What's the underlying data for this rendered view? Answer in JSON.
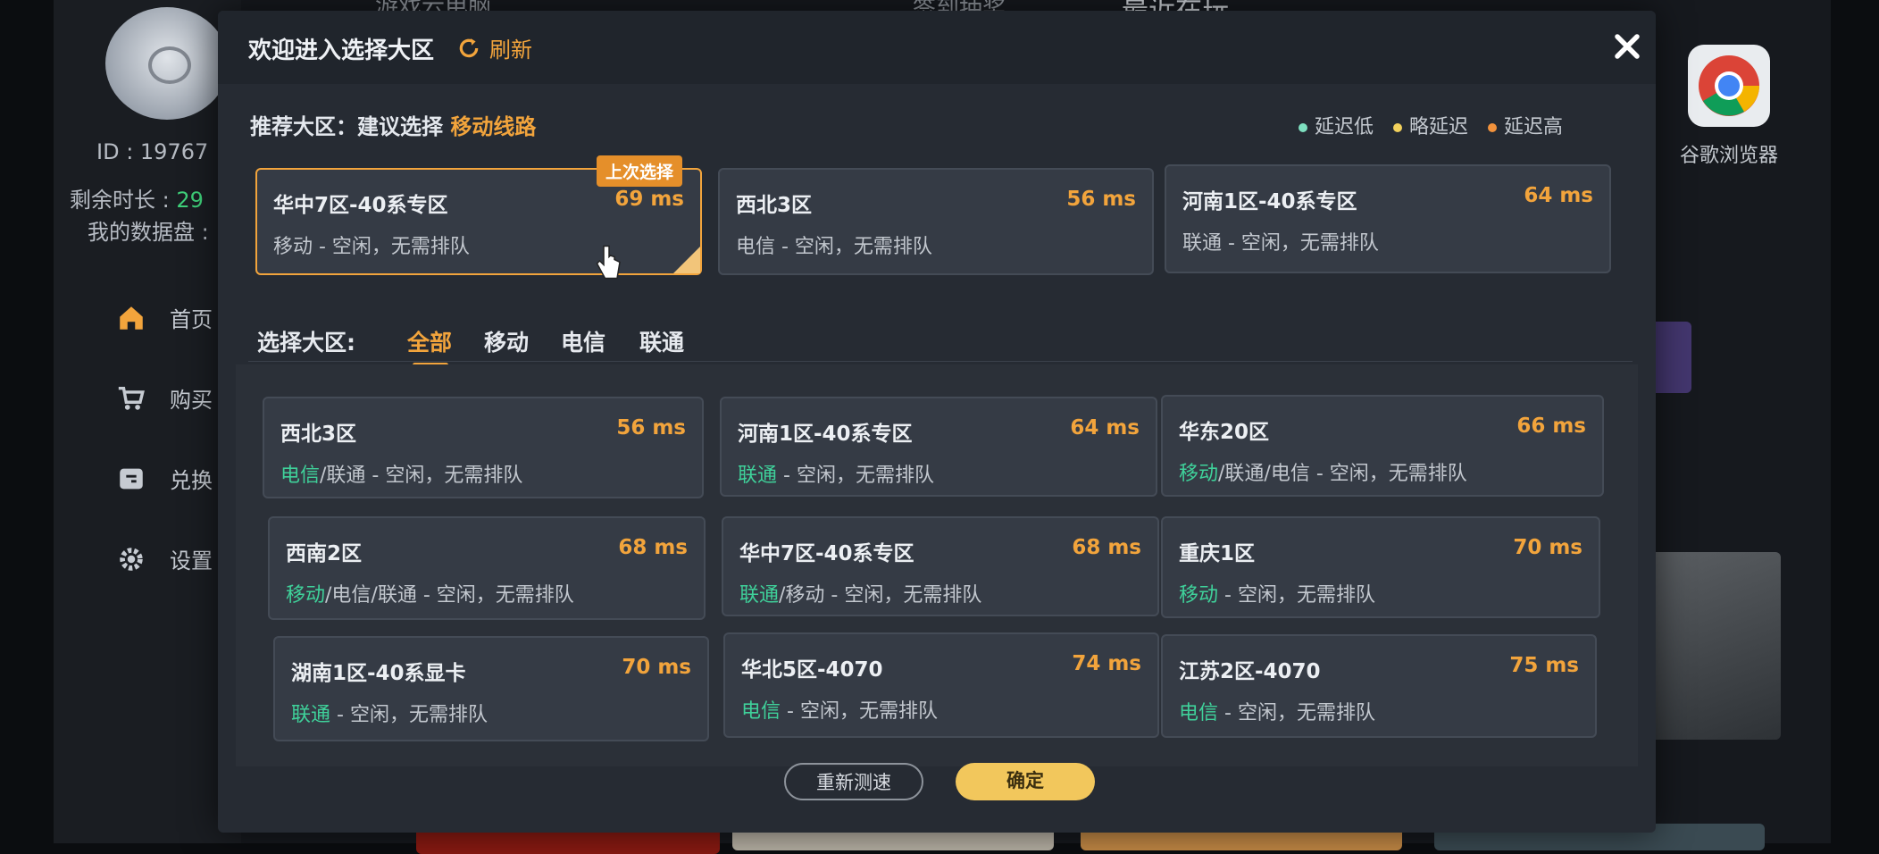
{
  "background_app": {
    "top_left_text": "游戏云电脑",
    "top_mid_text": "签到抽奖",
    "top_right_text": "最近在玩",
    "user_id": "ID : 19767",
    "remaining_time_label": "剩余时长 : ",
    "remaining_time_value": "29",
    "my_data_disk": "我的数据盘 :",
    "nav": [
      {
        "label": "首页",
        "icon": "home-icon"
      },
      {
        "label": "购买",
        "icon": "cart-icon"
      },
      {
        "label": "兑换",
        "icon": "exchange-icon"
      },
      {
        "label": "设置",
        "icon": "gear-icon"
      }
    ],
    "desktop_app": {
      "label": "谷歌浏览器",
      "icon": "chrome-icon"
    }
  },
  "modal": {
    "title": "欢迎进入选择大区",
    "refresh_label": "刷新",
    "recommend_prefix": "推荐大区：建议选择",
    "recommend_accent": "移动线路",
    "legend": [
      {
        "label": "延迟低",
        "color": "#7ee0c0"
      },
      {
        "label": "略延迟",
        "color": "#f2d15c"
      },
      {
        "label": "延迟高",
        "color": "#f2923c"
      }
    ],
    "last_choice_badge": "上次选择",
    "recommended": [
      {
        "name": "华中7区-40系专区",
        "ms": "69 ms",
        "isp_hi": "",
        "status": "移动 - 空闲，无需排队"
      },
      {
        "name": "西北3区",
        "ms": "56 ms",
        "isp_hi": "",
        "status": "电信 - 空闲，无需排队"
      },
      {
        "name": "河南1区-40系专区",
        "ms": "64 ms",
        "isp_hi": "",
        "status": "联通 - 空闲，无需排队"
      }
    ],
    "select_label": "选择大区:",
    "tabs": [
      "全部",
      "移动",
      "电信",
      "联通"
    ],
    "active_tab": 0,
    "regions": [
      {
        "name": "西北3区",
        "ms": "56 ms",
        "isp_hi": "电信",
        "status": "/联通 - 空闲，无需排队"
      },
      {
        "name": "河南1区-40系专区",
        "ms": "64 ms",
        "isp_hi": "联通",
        "status": " - 空闲，无需排队"
      },
      {
        "name": "华东20区",
        "ms": "66 ms",
        "isp_hi": "移动",
        "status": "/联通/电信 - 空闲，无需排队"
      },
      {
        "name": "西南2区",
        "ms": "68 ms",
        "isp_hi": "移动",
        "status": "/电信/联通 - 空闲，无需排队"
      },
      {
        "name": "华中7区-40系专区",
        "ms": "68 ms",
        "isp_hi": "联通",
        "status": "/移动 - 空闲，无需排队"
      },
      {
        "name": "重庆1区",
        "ms": "70 ms",
        "isp_hi": "移动",
        "status": " - 空闲，无需排队"
      },
      {
        "name": "湖南1区-40系显卡",
        "ms": "70 ms",
        "isp_hi": "联通",
        "status": " - 空闲，无需排队"
      },
      {
        "name": "华北5区-4070",
        "ms": "74 ms",
        "isp_hi": "电信",
        "status": " - 空闲，无需排队"
      },
      {
        "name": "江苏2区-4070",
        "ms": "75 ms",
        "isp_hi": "电信",
        "status": " - 空闲，无需排队"
      }
    ],
    "retest_label": "重新测速",
    "confirm_label": "确定"
  }
}
